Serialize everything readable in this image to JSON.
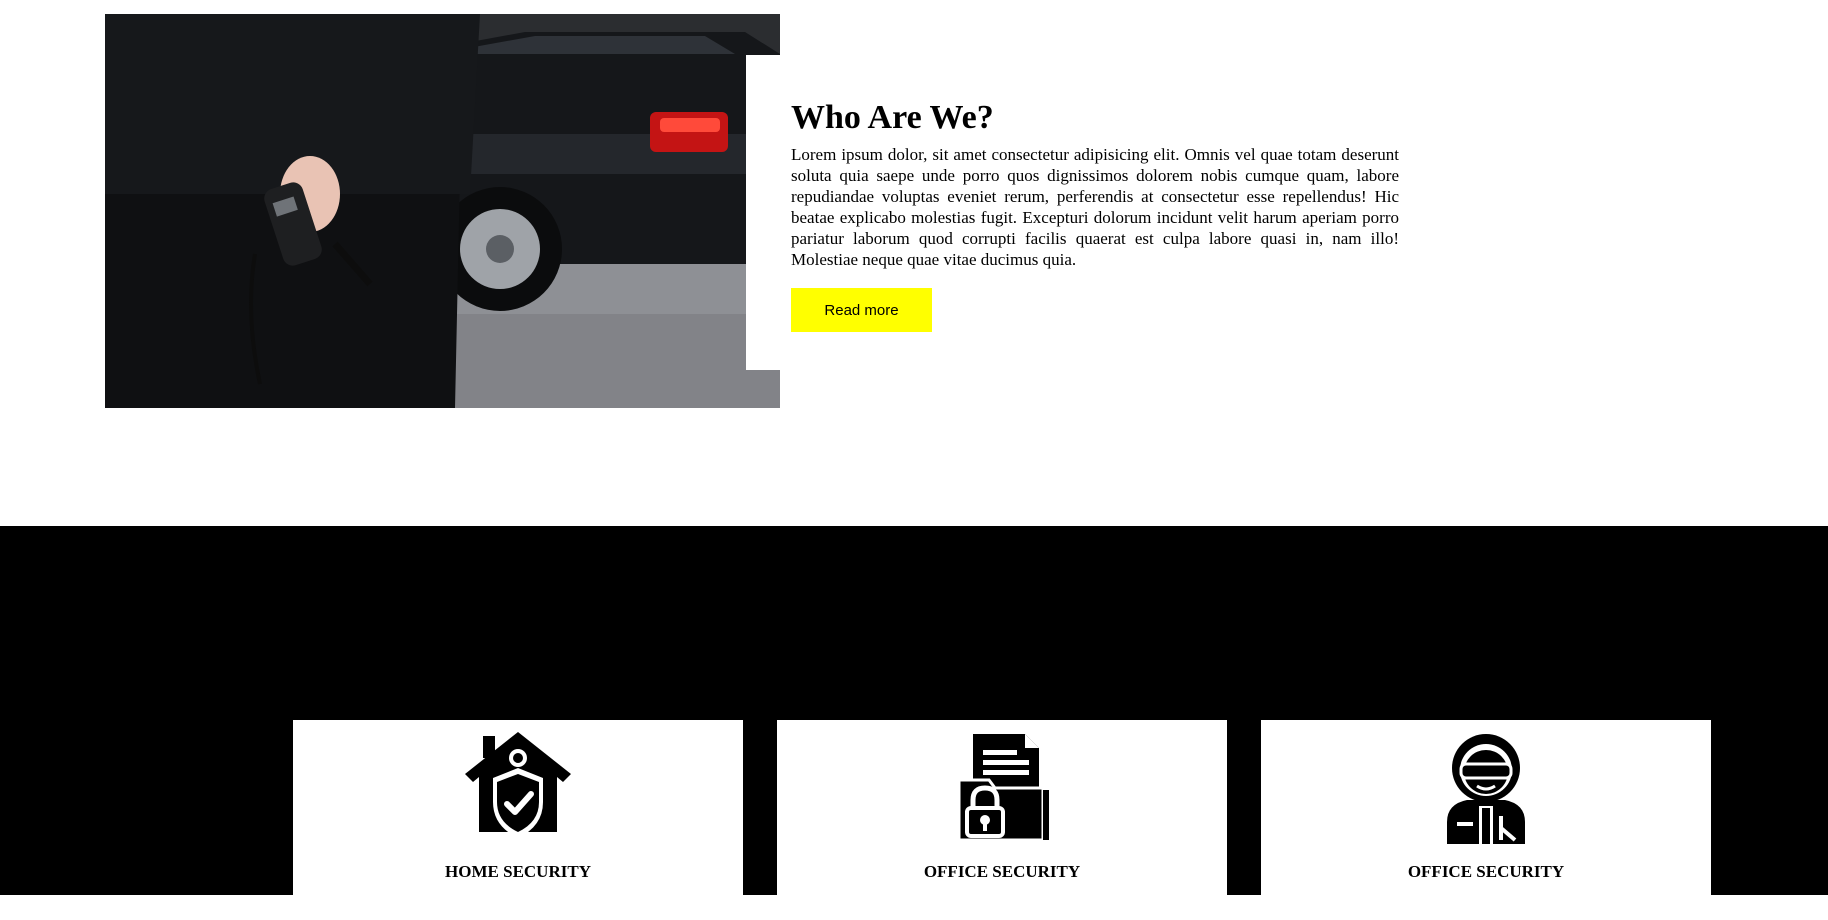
{
  "about": {
    "title": "Who Are We?",
    "body": "Lorem ipsum dolor, sit amet consectetur adipisicing elit. Omnis vel quae totam deserunt soluta quia saepe unde porro quos dignissimos dolorem nobis cumque quam, labore repudiandae voluptas eveniet rerum, perferendis at consectetur esse repellendus! Hic beatae explicabo molestias fugit. Excepturi dolorum incidunt velit harum aperiam porro pariatur laborum quod corrupti facilis quaerat est culpa labore quasi in, nam illo! Molestiae neque quae vitae ducimus quia.",
    "button_label": "Read more",
    "button_color": "#ffff00",
    "photo_icon": "security-guard-with-radio-photo"
  },
  "services": {
    "background": "#000000",
    "cards": [
      {
        "label": "HOME SECURITY",
        "icon": "home-shield-icon"
      },
      {
        "label": "OFFICE SECURITY",
        "icon": "locked-folder-icon"
      },
      {
        "label": "OFFICE SECURITY",
        "icon": "security-agent-icon"
      }
    ]
  }
}
